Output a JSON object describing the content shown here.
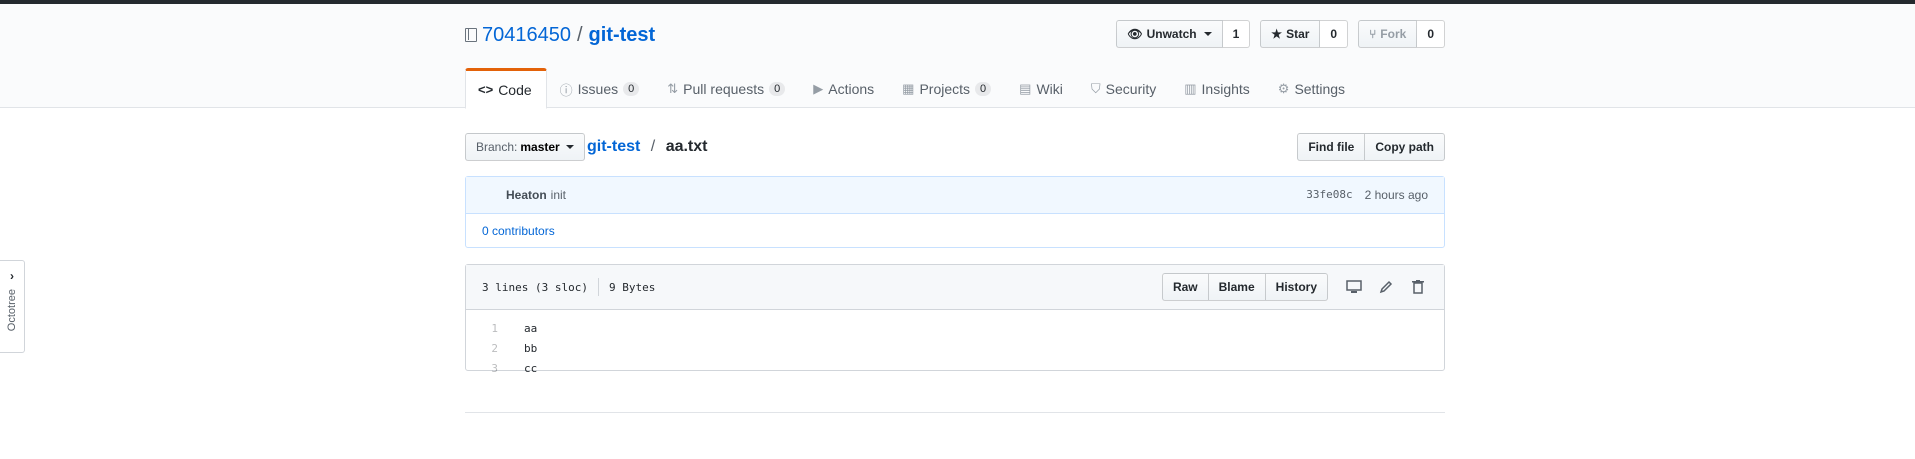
{
  "repo": {
    "owner": "70416450",
    "separator": "/",
    "name": "git-test"
  },
  "actions": {
    "watch": {
      "label": "Unwatch",
      "count": "1"
    },
    "star": {
      "label": "Star",
      "count": "0"
    },
    "fork": {
      "label": "Fork",
      "count": "0"
    }
  },
  "tabs": [
    {
      "icon": "<>",
      "label": "Code",
      "counter": ""
    },
    {
      "icon": "ⓘ",
      "label": "Issues",
      "counter": "0"
    },
    {
      "icon": "⇅",
      "label": "Pull requests",
      "counter": "0"
    },
    {
      "icon": "▶",
      "label": "Actions",
      "counter": ""
    },
    {
      "icon": "▦",
      "label": "Projects",
      "counter": "0"
    },
    {
      "icon": "▤",
      "label": "Wiki",
      "counter": ""
    },
    {
      "icon": "⛉",
      "label": "Security",
      "counter": ""
    },
    {
      "icon": "▥",
      "label": "Insights",
      "counter": ""
    },
    {
      "icon": "⚙",
      "label": "Settings",
      "counter": ""
    }
  ],
  "filenav": {
    "branch_label": "Branch:",
    "branch_name": "master",
    "breadcrumb_repo": "git-test",
    "breadcrumb_sep": "/",
    "breadcrumb_file": "aa.txt",
    "find_file": "Find file",
    "copy_path": "Copy path"
  },
  "commit": {
    "author": "Heaton",
    "message": "init",
    "sha": "33fe08c",
    "time": "2 hours ago",
    "contributors": "0 contributors"
  },
  "file": {
    "lines_info": "3 lines (3 sloc)",
    "size": "9 Bytes",
    "raw": "Raw",
    "blame": "Blame",
    "history": "History",
    "lines": [
      {
        "num": "1",
        "text": "aa"
      },
      {
        "num": "2",
        "text": "bb"
      },
      {
        "num": "3",
        "text": "cc"
      }
    ]
  },
  "octotree": {
    "label": "Octotree"
  },
  "colors": {
    "accent": "#0366d6",
    "tab_indicator": "#e36209"
  }
}
